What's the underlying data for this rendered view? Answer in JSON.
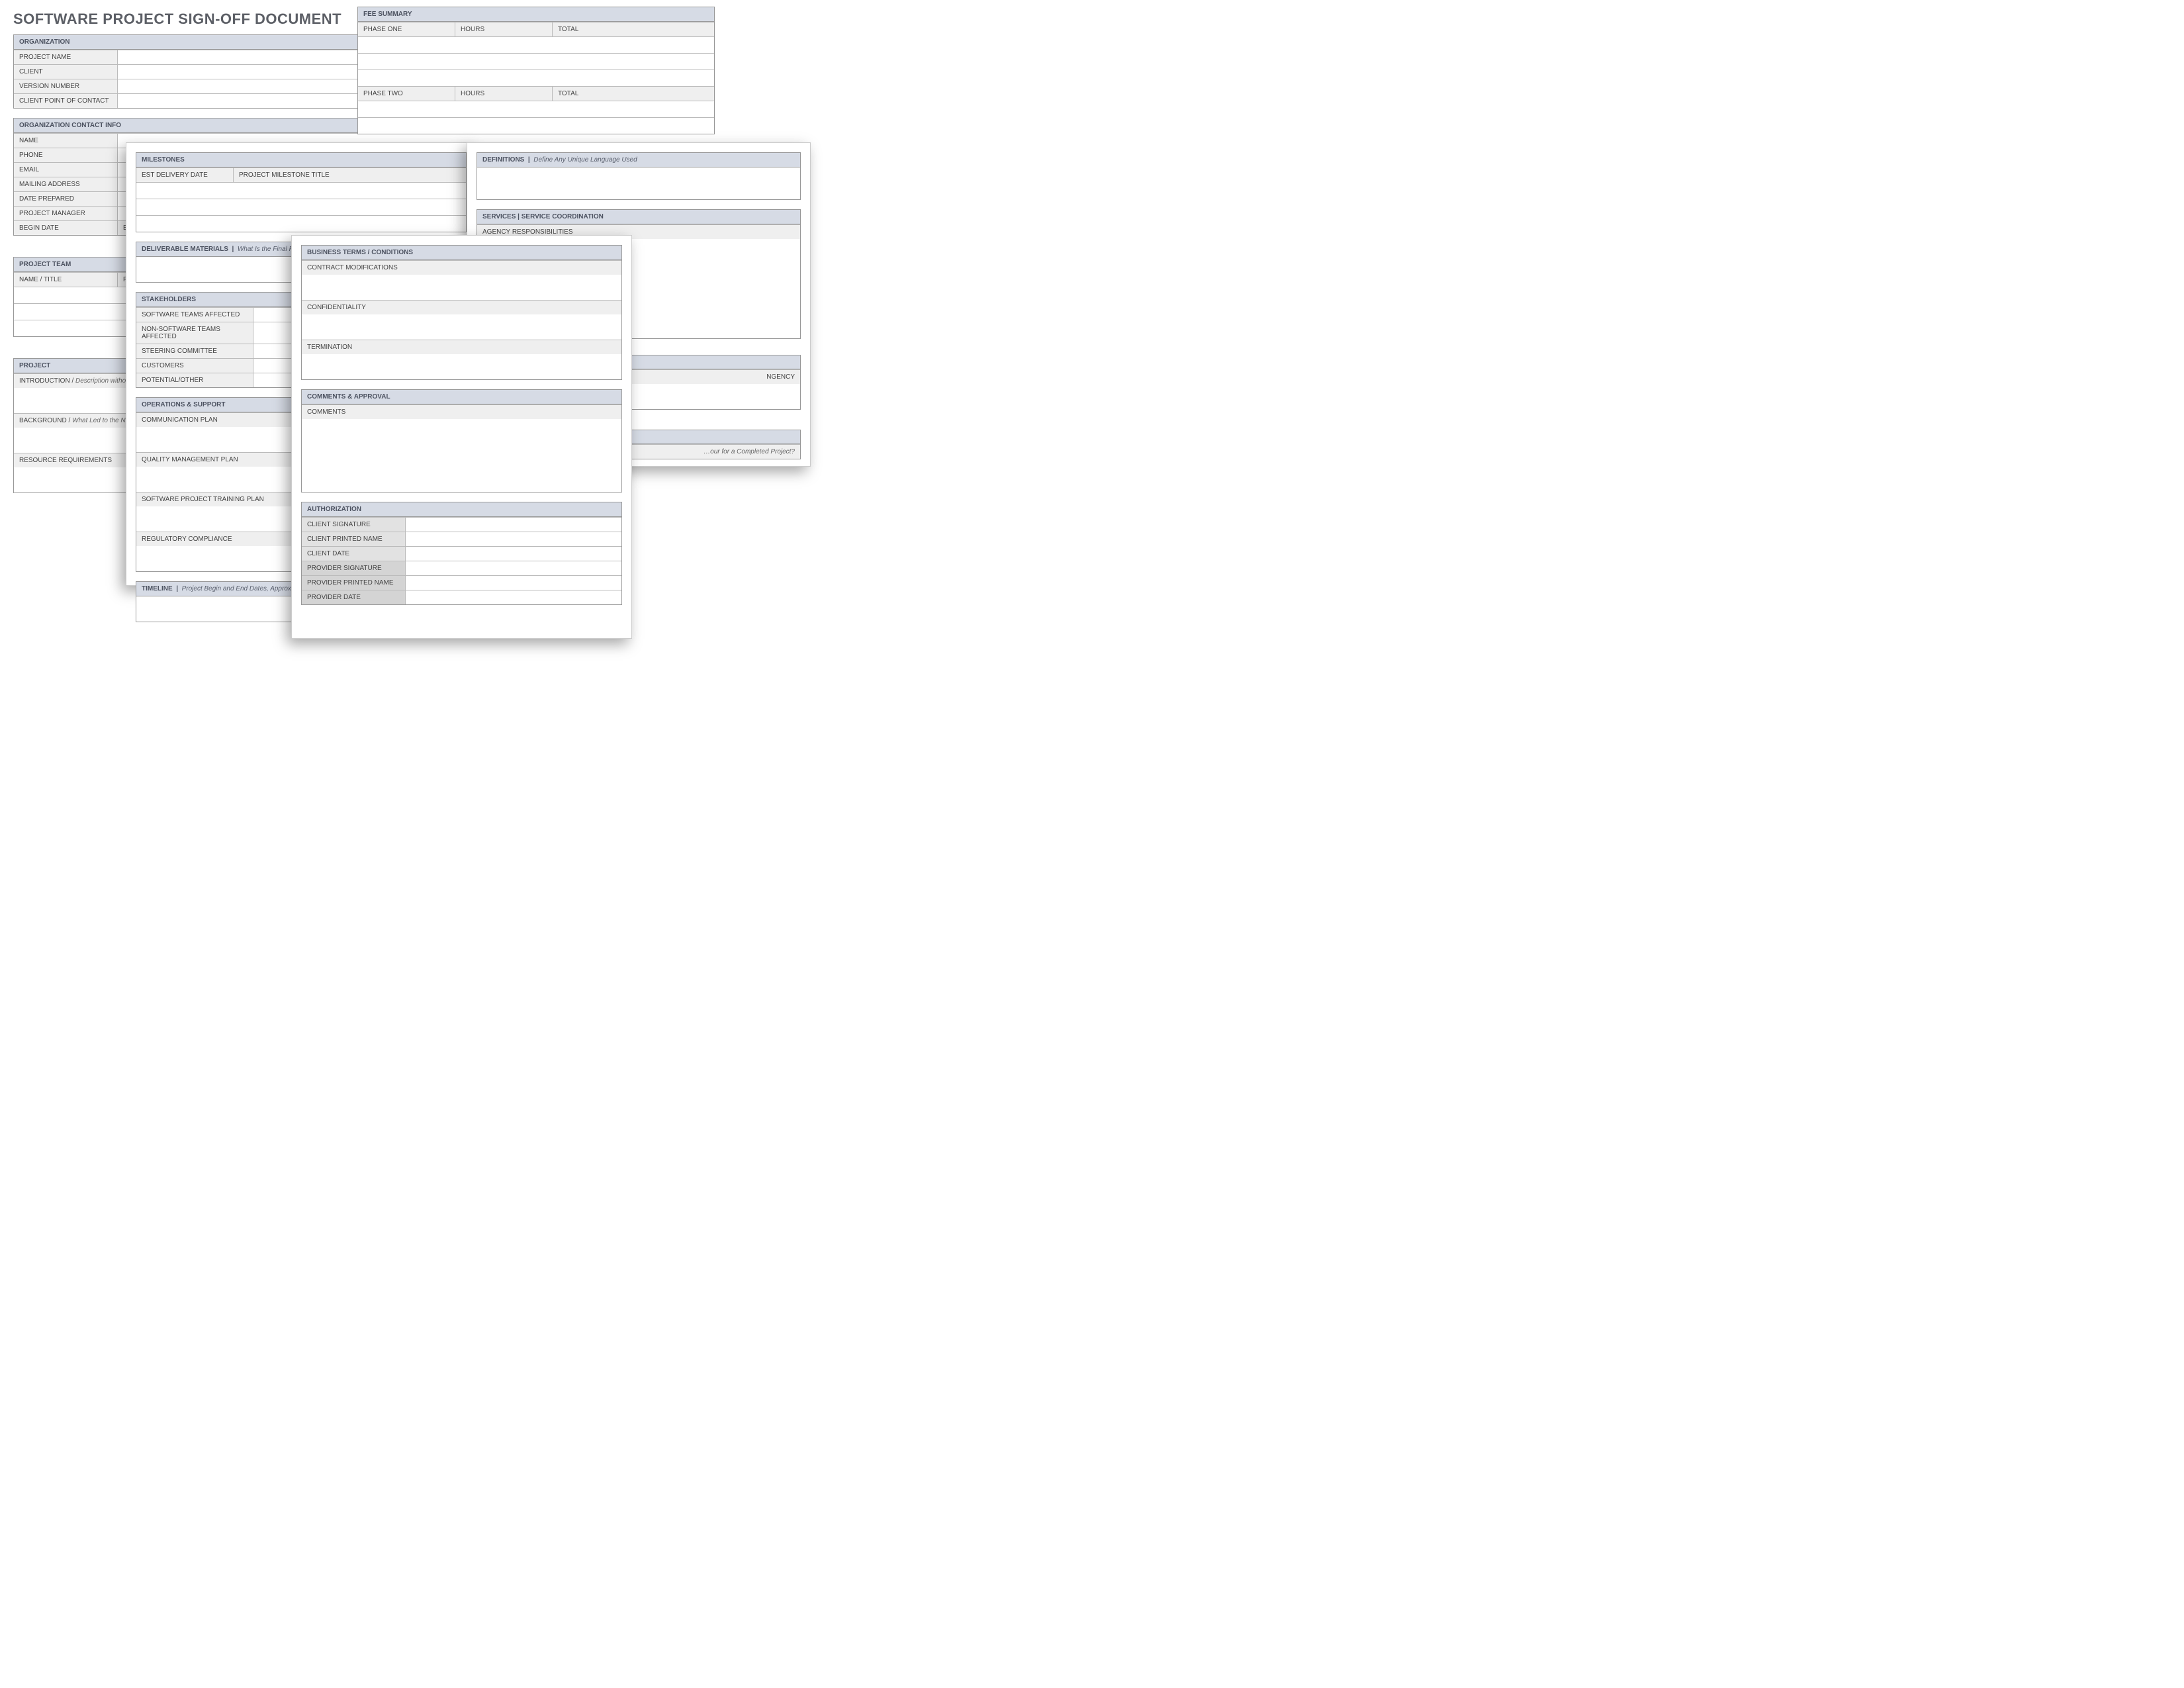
{
  "title": "SOFTWARE PROJECT SIGN-OFF DOCUMENT",
  "organization": {
    "header": "ORGANIZATION",
    "rows": [
      "PROJECT NAME",
      "CLIENT",
      "VERSION NUMBER",
      "CLIENT POINT OF CONTACT"
    ]
  },
  "contact": {
    "header": "ORGANIZATION CONTACT INFO",
    "rows": [
      "NAME",
      "PHONE",
      "EMAIL",
      "MAILING ADDRESS",
      "DATE PREPARED",
      "PROJECT MANAGER"
    ],
    "begin": "BEGIN DATE",
    "end": "END DATE"
  },
  "team": {
    "header": "PROJECT TEAM",
    "cols": [
      "NAME / TITLE",
      "PHONE"
    ]
  },
  "project": {
    "header": "PROJECT",
    "intro_label": "INTRODUCTION /",
    "intro_hint": "Description without Requ…",
    "background_label": "BACKGROUND /",
    "background_hint": "What Led to the Necess…",
    "resource_label": "RESOURCE REQUIREMENTS"
  },
  "fee": {
    "header": "FEE SUMMARY",
    "phase1": "PHASE ONE",
    "phase2": "PHASE TWO",
    "hours": "HOURS",
    "total": "TOTAL"
  },
  "milestones": {
    "header": "MILESTONES",
    "cols": [
      "EST DELIVERY DATE",
      "PROJECT MILESTONE TITLE"
    ]
  },
  "deliverables": {
    "header": "DELIVERABLE MATERIALS",
    "hint": "What Is the Final Product to Be…"
  },
  "stakeholders": {
    "header": "STAKEHOLDERS",
    "rows": [
      "SOFTWARE TEAMS AFFECTED",
      "NON-SOFTWARE TEAMS AFFECTED",
      "STEERING COMMITTEE",
      "CUSTOMERS",
      "POTENTIAL/OTHER"
    ]
  },
  "ops": {
    "header": "OPERATIONS & SUPPORT",
    "rows": [
      "COMMUNICATION PLAN",
      "QUALITY MANAGEMENT PLAN",
      "SOFTWARE PROJECT TRAINING PLAN",
      "REGULATORY COMPLIANCE"
    ]
  },
  "timeline": {
    "header": "TIMELINE",
    "hint": "Project Begin and End Dates, Approximate Deliv…"
  },
  "definitions": {
    "header": "DEFINITIONS",
    "hint": "Define Any Unique Language Used"
  },
  "services": {
    "header": "SERVICES  |  SERVICE COORDINATION",
    "rows": [
      "AGENCY RESPONSIBILITIES"
    ]
  },
  "ngency": "NGENCY",
  "completed_hint": "…our for a Completed Project?",
  "terms": {
    "header": "BUSINESS TERMS  /  CONDITIONS",
    "rows": [
      "CONTRACT MODIFICATIONS",
      "CONFIDENTIALITY",
      "TERMINATION"
    ]
  },
  "comments": {
    "header": "COMMENTS & APPROVAL",
    "label": "COMMENTS"
  },
  "auth": {
    "header": "AUTHORIZATION",
    "client": [
      "CLIENT SIGNATURE",
      "CLIENT PRINTED NAME",
      "CLIENT DATE"
    ],
    "provider": [
      "PROVIDER SIGNATURE",
      "PROVIDER PRINTED NAME",
      "PROVIDER DATE"
    ]
  }
}
